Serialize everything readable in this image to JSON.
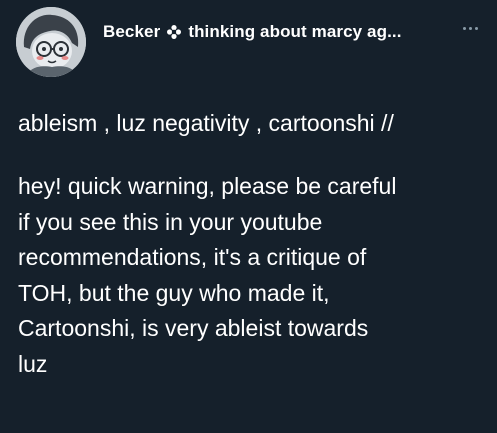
{
  "tweet": {
    "author": {
      "name_before_icon": "Becker",
      "name_icon": "flower-icon",
      "name_after_icon": "thinking about marcy ag...",
      "avatar_icon": "avatar"
    },
    "menu_icon": "more-icon",
    "content_warning": "ableism , luz negativity , cartoonshi //",
    "body_lines": [
      "hey! quick warning, please be careful",
      "if you see this in your youtube",
      "recommendations, it's a critique of",
      "TOH, but the guy who made it,",
      "Cartoonshi, is very ableist towards",
      "luz"
    ]
  },
  "colors": {
    "background": "#15202b",
    "text": "#ffffff",
    "muted": "#8899a6"
  }
}
